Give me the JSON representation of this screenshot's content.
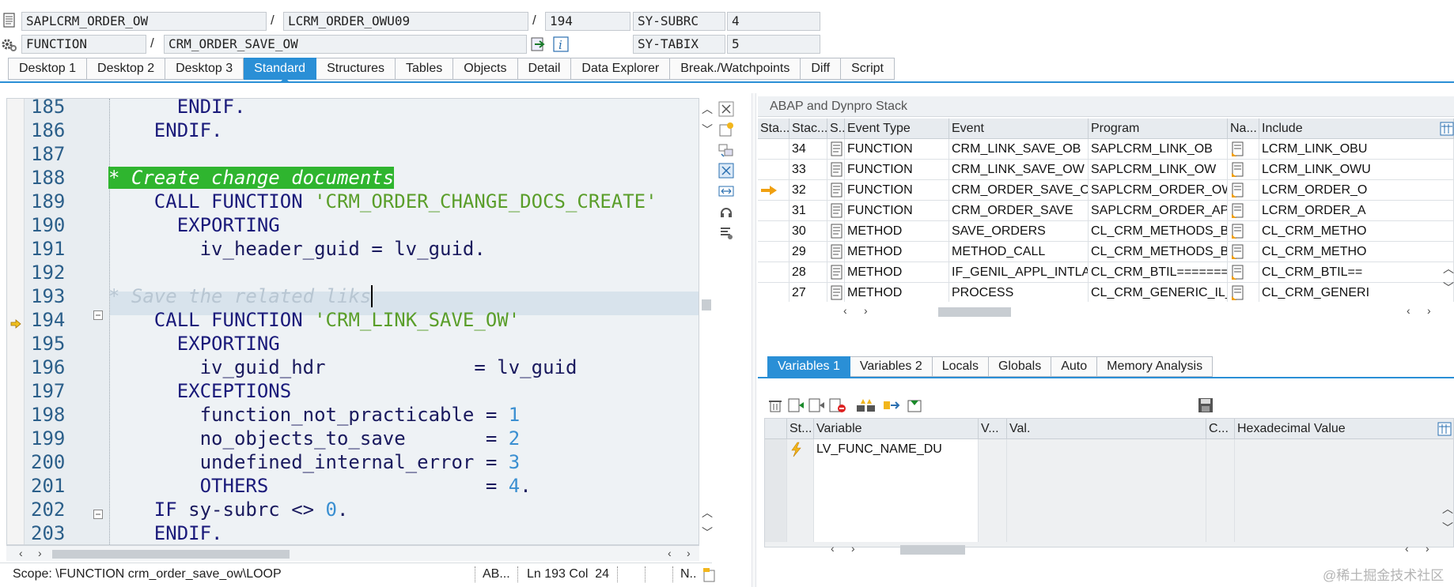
{
  "header": {
    "row1": {
      "program": "SAPLCRM_ORDER_OW",
      "sep1": "/",
      "include": "LCRM_ORDER_OWU09",
      "sep2": "/",
      "line": "194",
      "sy_label": "SY-SUBRC",
      "sy_value": "4"
    },
    "row2": {
      "type": "FUNCTION",
      "sep1": "/",
      "name": "CRM_ORDER_SAVE_OW",
      "sy_label": "SY-TABIX",
      "sy_value": "5"
    },
    "icons": [
      "program-icon",
      "settings-gear-icon",
      "jump-to-source-icon",
      "info-icon"
    ]
  },
  "tabs": [
    {
      "label": "Desktop 1",
      "active": false
    },
    {
      "label": "Desktop 2",
      "active": false
    },
    {
      "label": "Desktop 3",
      "active": false
    },
    {
      "label": "Standard",
      "active": true
    },
    {
      "label": "Structures",
      "active": false
    },
    {
      "label": "Tables",
      "active": false
    },
    {
      "label": "Objects",
      "active": false
    },
    {
      "label": "Detail",
      "active": false
    },
    {
      "label": "Data Explorer",
      "active": false
    },
    {
      "label": "Break./Watchpoints",
      "active": false
    },
    {
      "label": "Diff",
      "active": false
    },
    {
      "label": "Script",
      "active": false
    }
  ],
  "editor": {
    "lines": [
      {
        "num": "185",
        "tokens": [
          [
            "kw",
            "      ENDIF."
          ]
        ]
      },
      {
        "num": "186",
        "tokens": [
          [
            "kw",
            "    ENDIF."
          ]
        ]
      },
      {
        "num": "187",
        "tokens": []
      },
      {
        "num": "188",
        "tokens": [
          [
            "cmt-green",
            "* Create change documents"
          ]
        ]
      },
      {
        "num": "189",
        "tokens": [
          [
            "kw",
            "    CALL FUNCTION "
          ],
          [
            "str",
            "'CRM_ORDER_CHANGE_DOCS_CREATE'"
          ]
        ]
      },
      {
        "num": "190",
        "tokens": [
          [
            "kw",
            "      EXPORTING"
          ]
        ]
      },
      {
        "num": "191",
        "tokens": [
          [
            "txt",
            "        iv_header_guid = lv_guid."
          ]
        ]
      },
      {
        "num": "192",
        "tokens": []
      },
      {
        "num": "193",
        "tokens": [
          [
            "cmt-sel",
            "* Save the related liks"
          ]
        ]
      },
      {
        "num": "194",
        "tokens": [
          [
            "kw",
            "    CALL FUNCTION "
          ],
          [
            "str",
            "'CRM_LINK_SAVE_OW'"
          ]
        ]
      },
      {
        "num": "195",
        "tokens": [
          [
            "kw",
            "      EXPORTING"
          ]
        ]
      },
      {
        "num": "196",
        "tokens": [
          [
            "txt",
            "        iv_guid_hdr             = lv_guid"
          ]
        ]
      },
      {
        "num": "197",
        "tokens": [
          [
            "kw",
            "      EXCEPTIONS"
          ]
        ]
      },
      {
        "num": "198",
        "tokens": [
          [
            "txt",
            "        function_not_practicable = "
          ],
          [
            "num",
            "1"
          ]
        ]
      },
      {
        "num": "199",
        "tokens": [
          [
            "txt",
            "        no_objects_to_save       = "
          ],
          [
            "num",
            "2"
          ]
        ]
      },
      {
        "num": "200",
        "tokens": [
          [
            "txt",
            "        undefined_internal_error = "
          ],
          [
            "num",
            "3"
          ]
        ]
      },
      {
        "num": "201",
        "tokens": [
          [
            "kw",
            "        OTHERS"
          ],
          [
            "txt",
            "                   = "
          ],
          [
            "num",
            "4"
          ],
          [
            "txt",
            "."
          ]
        ]
      },
      {
        "num": "202",
        "tokens": [
          [
            "kw",
            "    IF "
          ],
          [
            "txt",
            "sy-subrc <> "
          ],
          [
            "num",
            "0"
          ],
          [
            "txt",
            "."
          ]
        ]
      },
      {
        "num": "203",
        "tokens": [
          [
            "kw",
            "    ENDIF."
          ]
        ]
      }
    ],
    "current_line": "194",
    "cursor_line": "193"
  },
  "status": {
    "scope": "Scope: \\FUNCTION crm_order_save_ow\\LOOP",
    "lang": "AB...",
    "position": "Ln 193 Col  24",
    "mode": "N.."
  },
  "stack": {
    "title": "ABAP and Dynpro Stack",
    "columns": [
      "Sta...",
      "Stac...",
      "S..",
      "Event Type",
      "Event",
      "Program",
      "Na...",
      "Include"
    ],
    "rows": [
      {
        "current": false,
        "level": "34",
        "type": "FUNCTION",
        "event": "CRM_LINK_SAVE_OB",
        "program": "SAPLCRM_LINK_OB",
        "include": "LCRM_LINK_OBU"
      },
      {
        "current": false,
        "level": "33",
        "type": "FUNCTION",
        "event": "CRM_LINK_SAVE_OW",
        "program": "SAPLCRM_LINK_OW",
        "include": "LCRM_LINK_OWU"
      },
      {
        "current": true,
        "level": "32",
        "type": "FUNCTION",
        "event": "CRM_ORDER_SAVE_OW",
        "program": "SAPLCRM_ORDER_OW",
        "include": "LCRM_ORDER_O"
      },
      {
        "current": false,
        "level": "31",
        "type": "FUNCTION",
        "event": "CRM_ORDER_SAVE",
        "program": "SAPLCRM_ORDER_API",
        "include": "LCRM_ORDER_A"
      },
      {
        "current": false,
        "level": "30",
        "type": "METHOD",
        "event": "SAVE_ORDERS",
        "program": "CL_CRM_METHODS_BTIL=...",
        "include": "CL_CRM_METHO"
      },
      {
        "current": false,
        "level": "29",
        "type": "METHOD",
        "event": "METHOD_CALL",
        "program": "CL_CRM_METHODS_BTIL=...",
        "include": "CL_CRM_METHO"
      },
      {
        "current": false,
        "level": "28",
        "type": "METHOD",
        "event": "IF_GENIL_APPL_INTLAY~...",
        "program": "CL_CRM_BTIL=========...",
        "include": "CL_CRM_BTIL=="
      },
      {
        "current": false,
        "level": "27",
        "type": "METHOD",
        "event": "PROCESS",
        "program": "CL_CRM_GENERIC_IL_NE...",
        "include": "CL_CRM_GENERI"
      }
    ]
  },
  "variables": {
    "tabs": [
      {
        "label": "Variables 1",
        "active": true
      },
      {
        "label": "Variables 2",
        "active": false
      },
      {
        "label": "Locals",
        "active": false
      },
      {
        "label": "Globals",
        "active": false
      },
      {
        "label": "Auto",
        "active": false
      },
      {
        "label": "Memory Analysis",
        "active": false
      }
    ],
    "columns": [
      "St...",
      "Variable",
      "V...",
      "Val.",
      "C...",
      "Hexadecimal Value"
    ],
    "rows": [
      {
        "status_icon": "lightning-icon",
        "variable": "LV_FUNC_NAME_DU",
        "value": "",
        "hex": ""
      }
    ]
  },
  "watermark": "@稀土掘金技术社区",
  "colors": {
    "accent": "#2a8fd6",
    "comment_green": "#2fb52f",
    "keyword": "#1a1a7a",
    "string": "#5a9e2a",
    "number": "#3a8fd1",
    "current_arrow": "#f0a010"
  }
}
